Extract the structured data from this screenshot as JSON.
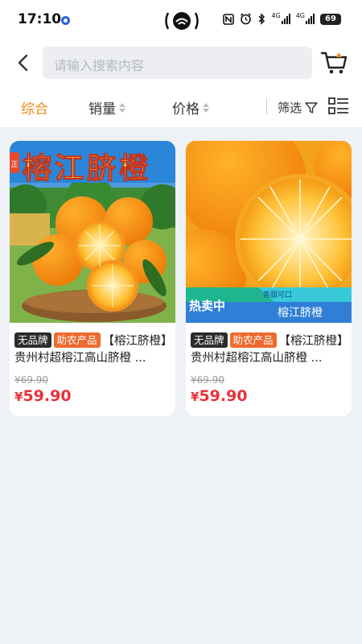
{
  "status_bar": {
    "time": "17:10",
    "network_1": "4G",
    "network_2": "4G",
    "battery": "69"
  },
  "header": {
    "search_placeholder": "请输入搜索内容"
  },
  "sort_bar": {
    "items": [
      {
        "label": "综合",
        "active": true
      },
      {
        "label": "销量",
        "active": false
      },
      {
        "label": "价格",
        "active": false
      }
    ],
    "filter_label": "筛选"
  },
  "products": [
    {
      "banner_text": "榕江脐橙",
      "banner_side": "正",
      "tags": [
        "无品牌",
        "助农产品"
      ],
      "title": "【榕江脐橙】贵州村超榕江高山脐橙 ...",
      "original_price": "¥69.90",
      "price_symbol": "¥",
      "price": "59.90"
    },
    {
      "ribbon_hot": "热卖中",
      "ribbon_small": "香甜可口",
      "ribbon_name": "榕江脐橙",
      "tags": [
        "无品牌",
        "助农产品"
      ],
      "title": "【榕江脐橙】贵州村超榕江高山脐橙 ...",
      "original_price": "¥69.90",
      "price_symbol": "¥",
      "price": "59.90"
    }
  ],
  "colors": {
    "accent": "#f08a14",
    "price": "#e8313a",
    "tag_farm": "#ef6a2e",
    "tag_brand": "#2b2b2b",
    "background": "#eef1f5"
  }
}
